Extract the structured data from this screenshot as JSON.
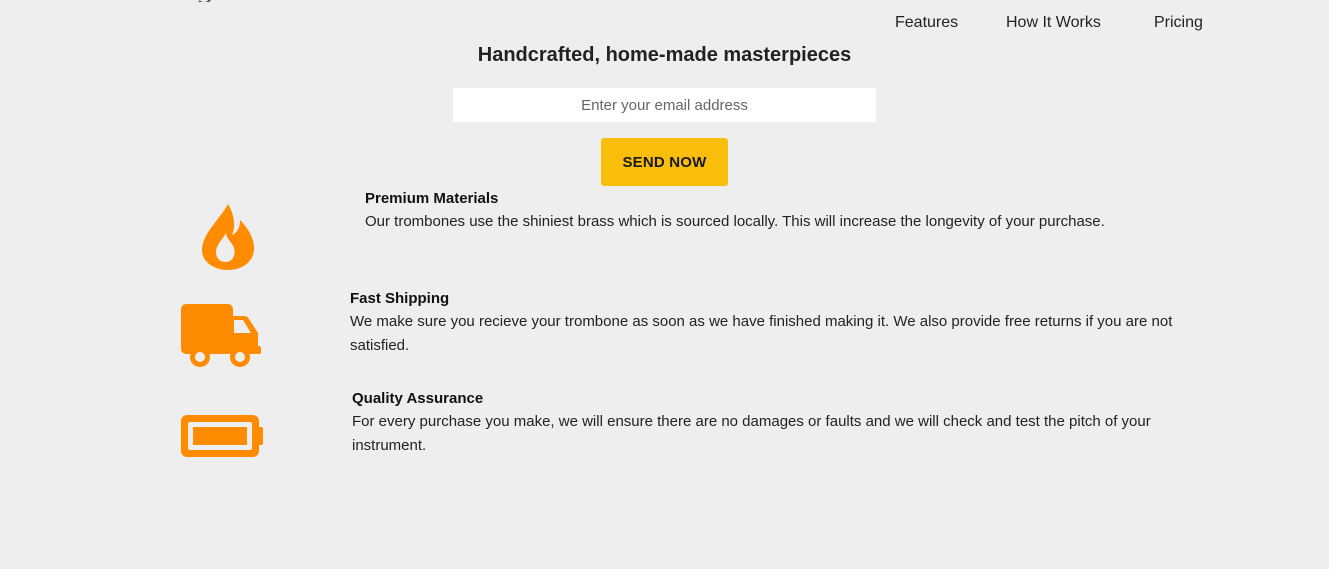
{
  "nav": {
    "links": [
      {
        "label": "Features"
      },
      {
        "label": "How It Works"
      },
      {
        "label": "Pricing"
      }
    ]
  },
  "hero": {
    "title": "Handcrafted, home-made masterpieces",
    "email_placeholder": "Enter your email address",
    "email_value": "",
    "send_label": "SEND NOW"
  },
  "features": [
    {
      "icon": "fire-icon",
      "title": "Premium Materials",
      "description": "Our trombones use the shiniest brass which is sourced locally. This will increase the longevity of your purchase."
    },
    {
      "icon": "truck-icon",
      "title": "Fast Shipping",
      "description": "We make sure you recieve your trombone as soon as we have finished making it. We also provide free returns if you are not satisfied."
    },
    {
      "icon": "battery-icon",
      "title": "Quality Assurance",
      "description": "For every purchase you make, we will ensure there are no damages or faults and we will check and test the pitch of your instrument."
    }
  ],
  "colors": {
    "background": "#eeeeee",
    "accent_button": "#f9bd0c",
    "icon_orange": "#ff8c00"
  }
}
